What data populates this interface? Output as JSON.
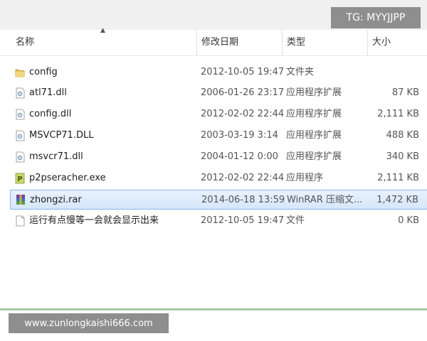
{
  "watermark_top": "TG: MYYJJPP",
  "watermark_bottom": "www.zunlongkaishi666.com",
  "columns": {
    "name": "名称",
    "modified": "修改日期",
    "type": "类型",
    "size": "大小"
  },
  "files": [
    {
      "name": "config",
      "date": "2012-10-05 19:47",
      "type": "文件夹",
      "size": "",
      "icon": "folder-icon"
    },
    {
      "name": "atl71.dll",
      "date": "2006-01-26 23:17",
      "type": "应用程序扩展",
      "size": "87 KB",
      "icon": "dll-file-icon"
    },
    {
      "name": "config.dll",
      "date": "2012-02-02 22:44",
      "type": "应用程序扩展",
      "size": "2,111 KB",
      "icon": "dll-file-icon"
    },
    {
      "name": "MSVCP71.DLL",
      "date": "2003-03-19 3:14",
      "type": "应用程序扩展",
      "size": "488 KB",
      "icon": "dll-file-icon"
    },
    {
      "name": "msvcr71.dll",
      "date": "2004-01-12 0:00",
      "type": "应用程序扩展",
      "size": "340 KB",
      "icon": "dll-file-icon"
    },
    {
      "name": "p2pseracher.exe",
      "date": "2012-02-02 22:44",
      "type": "应用程序",
      "size": "2,111 KB",
      "icon": "exe-file-icon"
    },
    {
      "name": "zhongzi.rar",
      "date": "2014-06-18 13:59",
      "type": "WinRAR 压缩文...",
      "size": "1,472 KB",
      "icon": "rar-archive-icon",
      "selected": true
    },
    {
      "name": "运行有点慢等一会就会显示出来",
      "date": "2012-10-05 19:47",
      "type": "文件",
      "size": "0 KB",
      "icon": "blank-file-icon"
    }
  ]
}
